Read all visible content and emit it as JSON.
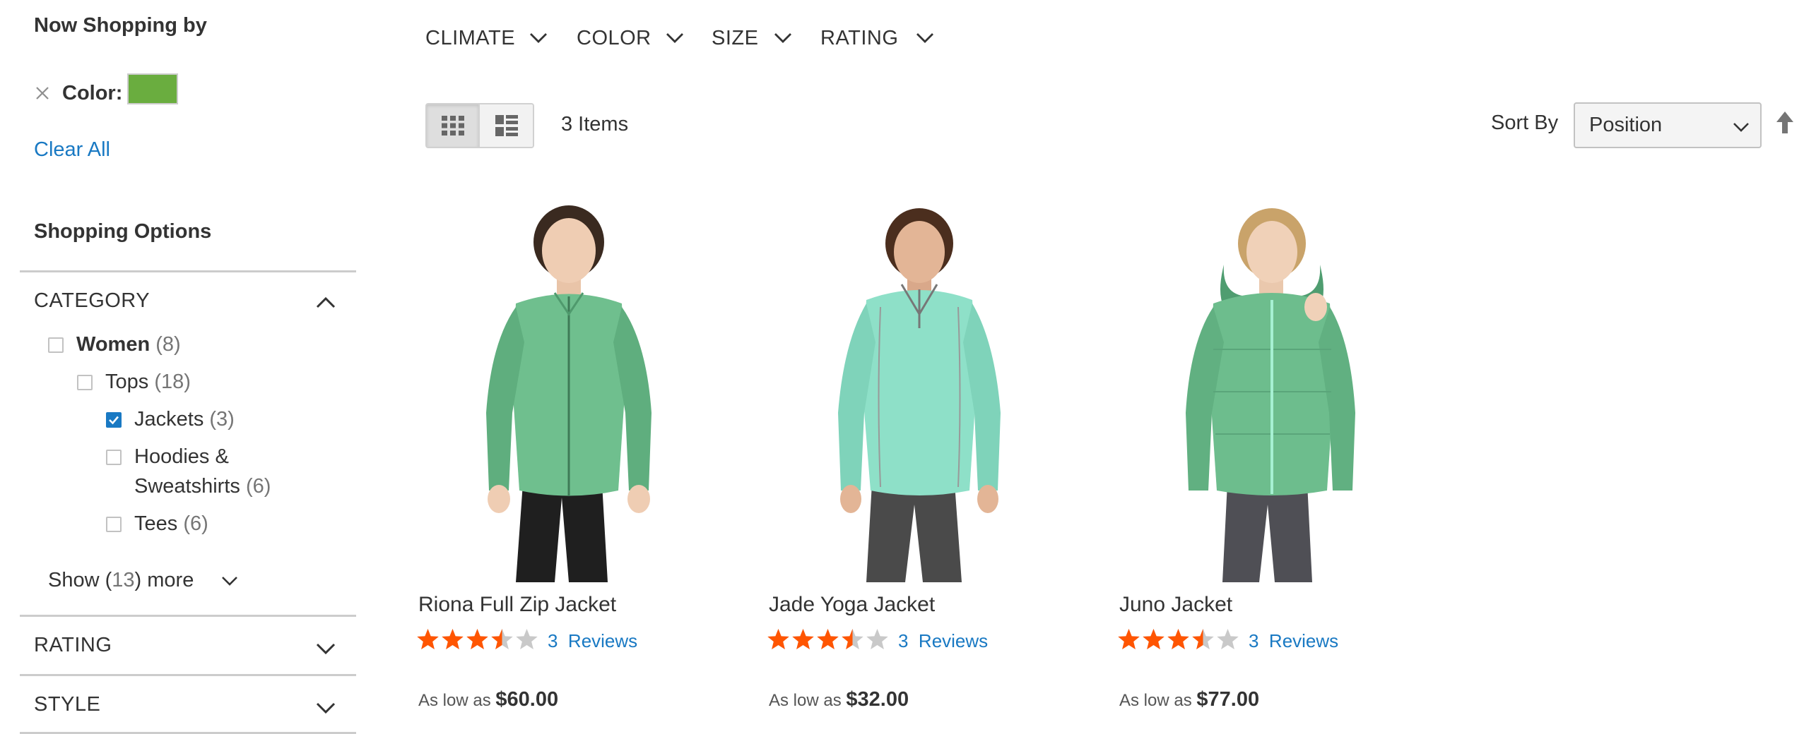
{
  "sidebar": {
    "now_shopping_title": "Now Shopping by",
    "active_filter": {
      "label": "Color:",
      "swatch_color": "#6aad3f"
    },
    "clear_all": "Clear All",
    "shopping_options_title": "Shopping Options",
    "category": {
      "title": "CATEGORY",
      "items": [
        {
          "label": "Women",
          "count": "(8)",
          "checked": false,
          "bold": true
        },
        {
          "label": "Tops",
          "count": "(18)",
          "checked": false
        },
        {
          "label": "Jackets",
          "count": "(3)",
          "checked": true
        },
        {
          "label_line1": "Hoodies &",
          "label_line2": "Sweatshirts",
          "count": "(6)",
          "checked": false
        },
        {
          "label": "Tees",
          "count": "(6)",
          "checked": false
        }
      ],
      "show_more": {
        "prefix": "Show (",
        "count": "13",
        "suffix": ") more"
      }
    },
    "rating_title": "RATING",
    "style_title": "STYLE"
  },
  "filters": [
    "CLIMATE",
    "COLOR",
    "SIZE",
    "RATING"
  ],
  "toolbar": {
    "items_count": "3 Items",
    "sort_label": "Sort By",
    "sort_value": "Position"
  },
  "products": [
    {
      "name": "Riona Full Zip Jacket",
      "rating": 3.5,
      "reviews_count": "3",
      "reviews_label": "Reviews",
      "price_prefix": "As low as",
      "price": "$60.00",
      "jacket_color": "#6fbf8e"
    },
    {
      "name": "Jade Yoga Jacket",
      "rating": 3.5,
      "reviews_count": "3",
      "reviews_label": "Reviews",
      "price_prefix": "As low as",
      "price": "$32.00",
      "jacket_color": "#8ee0c8"
    },
    {
      "name": "Juno Jacket",
      "rating": 3.5,
      "reviews_count": "3",
      "reviews_label": "Reviews",
      "price_prefix": "As low as",
      "price": "$77.00",
      "jacket_color": "#6dbd8d"
    }
  ],
  "colors": {
    "accent_link": "#1979c3",
    "star_on": "#ff5501",
    "star_off": "#c9c9c9"
  }
}
